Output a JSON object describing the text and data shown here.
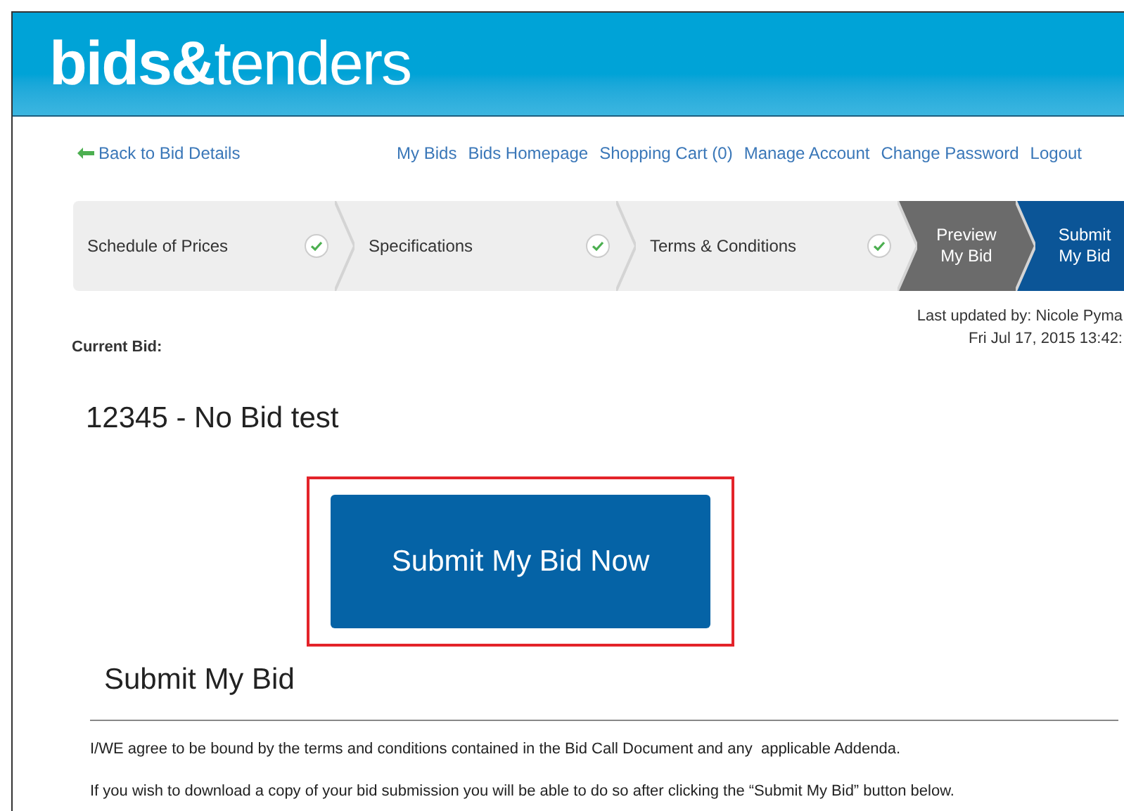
{
  "header": {
    "logo_bold": "bids&",
    "logo_light": "tenders"
  },
  "back_link": "Back to Bid Details",
  "nav_links": [
    "My Bids",
    "Bids Homepage",
    "Shopping Cart (0)",
    "Manage Account",
    "Change Password",
    "Logout"
  ],
  "steps": [
    {
      "label": "Schedule of Prices",
      "completed": true,
      "selected": false
    },
    {
      "label": "Specifications",
      "completed": true,
      "selected": false
    },
    {
      "label": "Terms & Conditions",
      "completed": true,
      "selected": false
    },
    {
      "label": "Preview My Bid",
      "completed": false,
      "selected": false
    },
    {
      "label": "Submit My Bid",
      "completed": false,
      "selected": true
    }
  ],
  "current_bid_label": "Current Bid:",
  "last_updated": [
    "Last updated by: Nicole Pyma",
    "Fri Jul 17, 2015 13:42:"
  ],
  "bid_title": "12345 - No Bid test",
  "submit_button": "Submit My Bid Now",
  "section_title": "Submit My Bid",
  "paragraphs": [
    "I/WE agree to be bound by the terms and conditions contained in the Bid Call Document and any  applicable Addenda.",
    "If you wish to download a copy of your bid submission you will be able to do so after clicking the “Submit My Bid” button below."
  ]
}
